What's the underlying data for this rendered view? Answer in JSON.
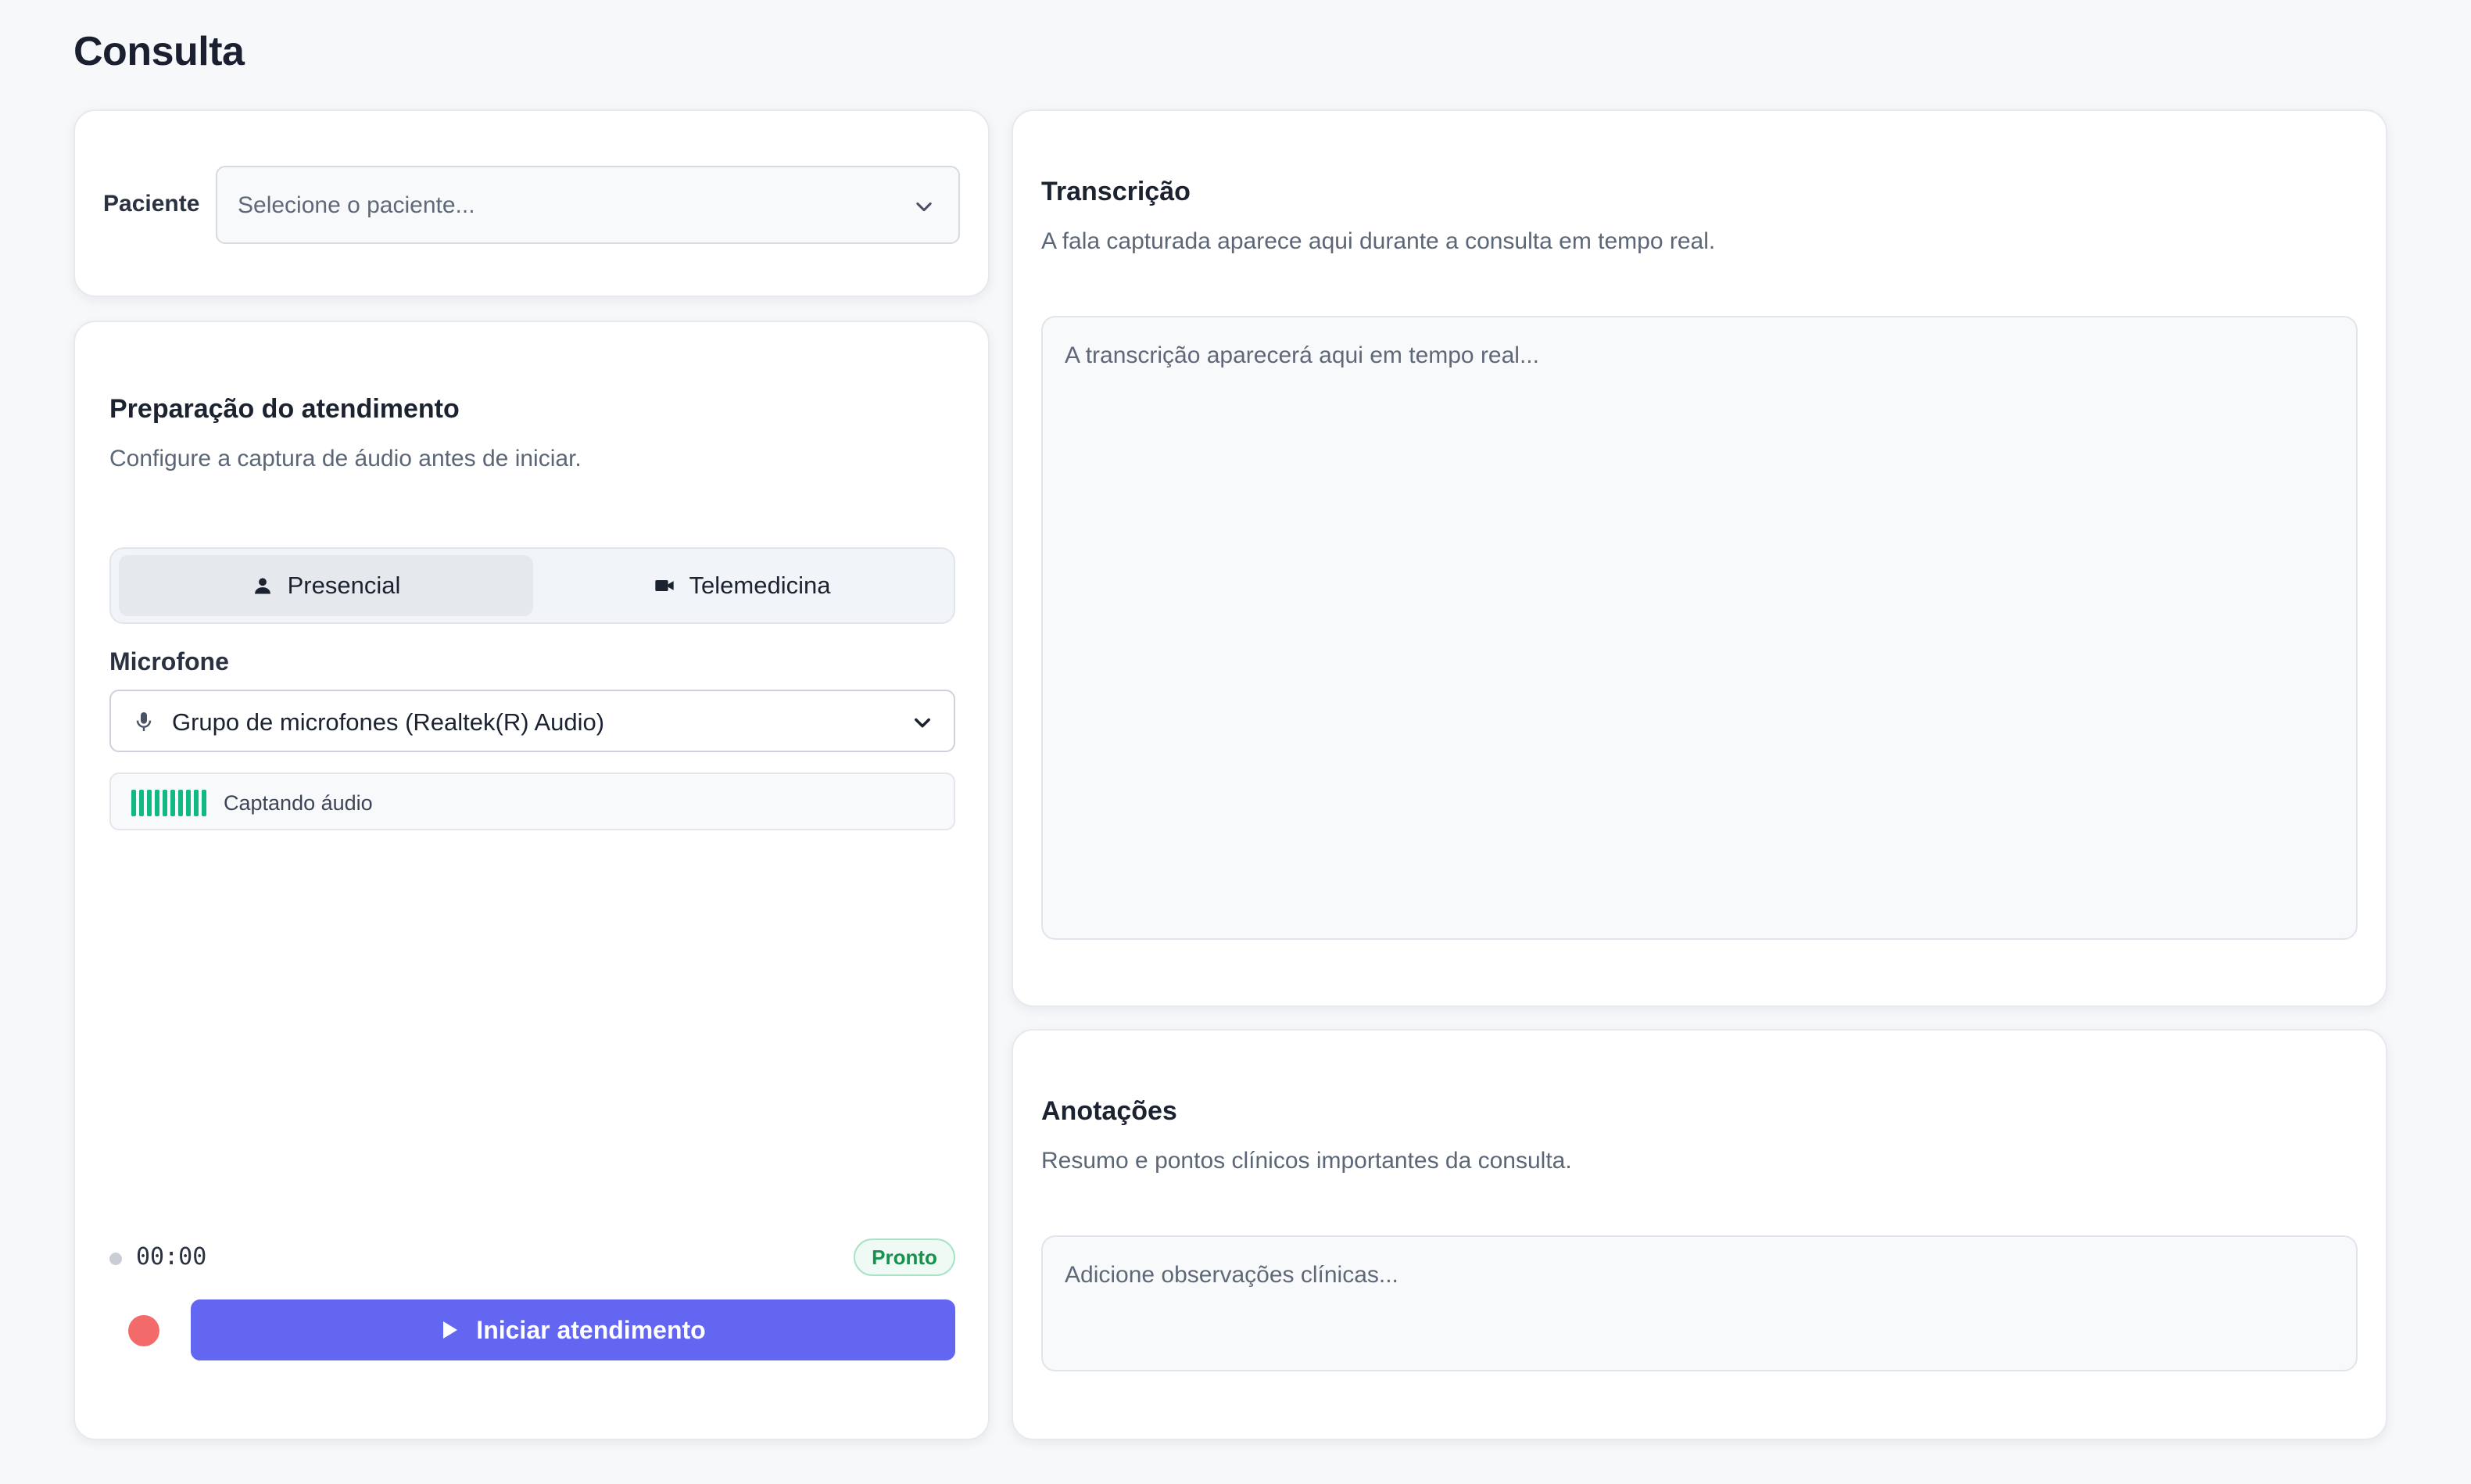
{
  "page": {
    "title": "Consulta"
  },
  "patient": {
    "label": "Paciente",
    "placeholder": "Selecione o paciente..."
  },
  "preparation": {
    "title": "Preparação do atendimento",
    "subtitle": "Configure a captura de áudio antes de iniciar.",
    "modes": [
      {
        "label": "Presencial",
        "icon": "person-icon",
        "selected": true
      },
      {
        "label": "Telemedicina",
        "icon": "video-camera-icon",
        "selected": false
      }
    ],
    "microphone": {
      "label": "Microfone",
      "selected": "Grupo de microfones (Realtek(R) Audio)"
    },
    "audio_level": {
      "status_text": "Captando áudio",
      "level": 1.0,
      "color": "#10b981"
    },
    "timer": "00:00",
    "status_badge": "Pronto",
    "start_button": "Iniciar atendimento",
    "accent_color": "#6366f1",
    "record_color": "#f26a6a"
  },
  "transcription": {
    "title": "Transcrição",
    "subtitle": "A fala capturada aparece aqui durante a consulta em tempo real.",
    "placeholder": "A transcrição aparecerá aqui em tempo real..."
  },
  "notes": {
    "title": "Anotações",
    "subtitle": "Resumo e pontos clínicos importantes da consulta.",
    "placeholder": "Adicione observações clínicas..."
  }
}
